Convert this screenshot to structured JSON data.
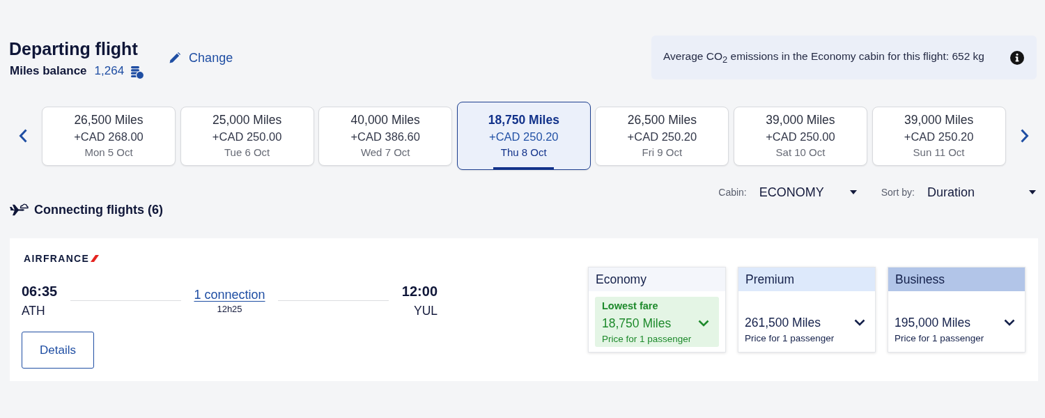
{
  "header": {
    "title": "Departing flight",
    "balance_label": "Miles balance",
    "balance_value": "1,264",
    "change_link": "Change"
  },
  "emissions_banner": {
    "text": "Average CO$_{2}$ emissions in the Economy cabin for this flight: 652 kg"
  },
  "date_carousel": {
    "days": [
      {
        "miles": "26,500 Miles",
        "price": "+CAD 268.00",
        "date": "Mon 5 Oct",
        "selected": false
      },
      {
        "miles": "25,000 Miles",
        "price": "+CAD 250.00",
        "date": "Tue 6 Oct",
        "selected": false
      },
      {
        "miles": "40,000 Miles",
        "price": "+CAD 386.60",
        "date": "Wed 7 Oct",
        "selected": false
      },
      {
        "miles": "18,750 Miles",
        "price": "+CAD 250.20",
        "date": "Thu 8 Oct",
        "selected": true
      },
      {
        "miles": "26,500 Miles",
        "price": "+CAD 250.20",
        "date": "Fri 9 Oct",
        "selected": false
      },
      {
        "miles": "39,000 Miles",
        "price": "+CAD 250.00",
        "date": "Sat 10 Oct",
        "selected": false
      },
      {
        "miles": "39,000 Miles",
        "price": "+CAD 250.20",
        "date": "Sun 11 Oct",
        "selected": false
      }
    ]
  },
  "filters": [
    {
      "label": "Cabin:",
      "value": "ECONOMY"
    },
    {
      "label": "Sort by:",
      "value": "Duration"
    }
  ],
  "results_heading": "Connecting flights (6)",
  "flights": [
    {
      "airline": "AIRFRANCE",
      "departure_time": "06:35",
      "departure_airport": "ATH",
      "connection_link": "1 connection",
      "duration": "12h25",
      "arrival_time": "12:00",
      "arrival_airport": "YUL",
      "details_button": "Details",
      "fares": [
        {
          "cabin": "Economy",
          "color": "#f4f6fb",
          "kind": "lowest",
          "badge": "Lowest fare",
          "miles": "18,750 Miles",
          "note": "Price for 1 passenger"
        },
        {
          "cabin": "Premium",
          "color": "#dde9fb",
          "kind": "standard",
          "miles": "261,500 Miles",
          "note": "Price for 1 passenger"
        },
        {
          "cabin": "Business",
          "color": "#b2c5e8",
          "kind": "standard",
          "miles": "195,000 Miles",
          "note": "Price for 1 passenger"
        }
      ]
    }
  ]
}
